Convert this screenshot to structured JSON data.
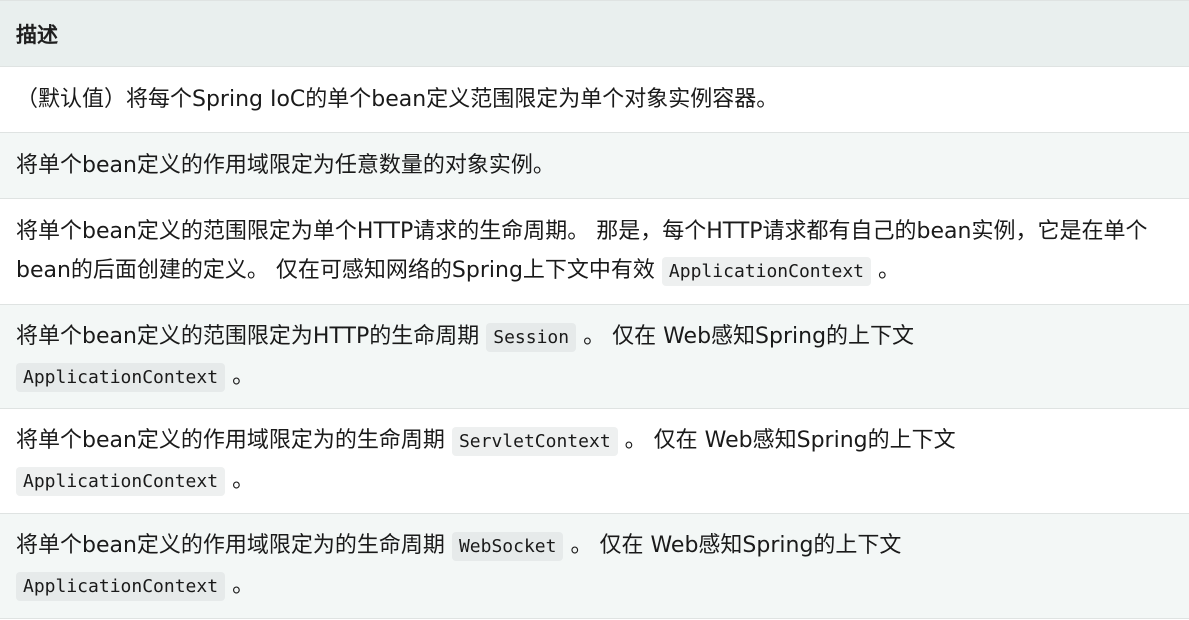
{
  "header": {
    "title": "描述"
  },
  "rows": [
    {
      "text": "（默认值）将每个Spring IoC的单个bean定义范围限定为单个对象实例容器。"
    },
    {
      "text": "将单个bean定义的作用域限定为任意数量的对象实例。"
    },
    {
      "text_a": "将单个bean定义的范围限定为单个HTTP请求的生命周期。 那是，每个HTTP请求都有自己的bean实例，它是在单个bean的后面创建的定义。 仅在可感知网络的Spring上下文中有效",
      "code": "ApplicationContext",
      "text_b": "。"
    },
    {
      "text_a": "将单个bean定义的范围限定为HTTP的生命周期",
      "code1": "Session",
      "text_b": "。 仅在 Web感知Spring的上下文",
      "code2": "ApplicationContext",
      "text_c": "。"
    },
    {
      "text_a": "将单个bean定义的作用域限定为的生命周期",
      "code1": "ServletContext",
      "text_b": "。 仅在 Web感知Spring的上下文",
      "code2": "ApplicationContext",
      "text_c": "。"
    },
    {
      "text_a": "将单个bean定义的作用域限定为的生命周期",
      "code1": "WebSocket",
      "text_b": "。 仅在 Web感知Spring的上下文",
      "code2": "ApplicationContext",
      "text_c": "。"
    }
  ]
}
